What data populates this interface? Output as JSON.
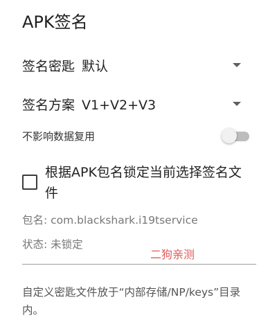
{
  "dialog": {
    "title": "APK签名"
  },
  "signing_key": {
    "label": "签名密匙",
    "value": "默认"
  },
  "signing_scheme": {
    "label": "签名方案",
    "value": "V1+V2+V3"
  },
  "data_reuse_toggle": {
    "label": "不影响数据复用",
    "state": "off"
  },
  "lock_checkbox": {
    "label": "根据APK包名锁定当前选择签名文件",
    "checked": false
  },
  "package_info": {
    "text": "包名: com.blackshark.i19tservice"
  },
  "status_info": {
    "text": "状态: 未锁定"
  },
  "watermark": {
    "text": "二狗亲测"
  },
  "note": {
    "text": "自定义密匙文件放于“内部存储/NP/keys”目录内。"
  },
  "colors": {
    "watermark": "#e05a5a",
    "switch_track_off": "#bdbdbd",
    "switch_thumb_off": "#f1f1f1"
  }
}
